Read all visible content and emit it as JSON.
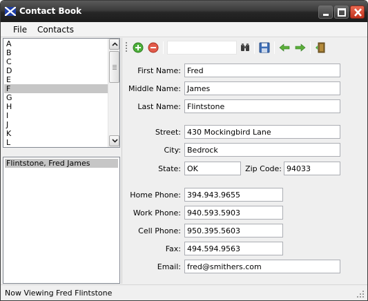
{
  "window": {
    "title": "Contact Book"
  },
  "menu": {
    "file": "File",
    "contacts": "Contacts"
  },
  "letters": [
    "A",
    "B",
    "C",
    "D",
    "E",
    "F",
    "G",
    "H",
    "I",
    "J",
    "K",
    "L"
  ],
  "letters_selected": "F",
  "contacts_list": [
    "Flintstone, Fred James"
  ],
  "toolbar": {
    "search_value": ""
  },
  "form": {
    "first_name": {
      "label": "First Name:",
      "value": "Fred"
    },
    "middle_name": {
      "label": "Middle Name:",
      "value": "James"
    },
    "last_name": {
      "label": "Last Name:",
      "value": "Flintstone"
    },
    "street": {
      "label": "Street:",
      "value": "430 Mockingbird Lane"
    },
    "city": {
      "label": "City:",
      "value": "Bedrock"
    },
    "state": {
      "label": "State:",
      "value": "OK"
    },
    "zip": {
      "label": "Zip Code:",
      "value": "94033"
    },
    "home_phone": {
      "label": "Home Phone:",
      "value": "394.943.9655"
    },
    "work_phone": {
      "label": "Work Phone:",
      "value": "940.593.5903"
    },
    "cell_phone": {
      "label": "Cell Phone:",
      "value": "950.395.5603"
    },
    "fax": {
      "label": "Fax:",
      "value": "494.594.9563"
    },
    "email": {
      "label": "Email:",
      "value": "fred@smithers.com"
    }
  },
  "status": {
    "text": "Now Viewing Fred Flintstone"
  },
  "icons": {
    "app": "scottish-flag-icon",
    "add": "add-contact-icon",
    "remove": "remove-contact-icon",
    "search": "binoculars-icon",
    "save": "floppy-disk-icon",
    "back": "arrow-left-icon",
    "forward": "arrow-right-icon",
    "exit": "exit-door-icon"
  },
  "colors": {
    "selection": "#c6c6c6",
    "titlebar": "#2b2b2b",
    "close": "#d9442c"
  }
}
